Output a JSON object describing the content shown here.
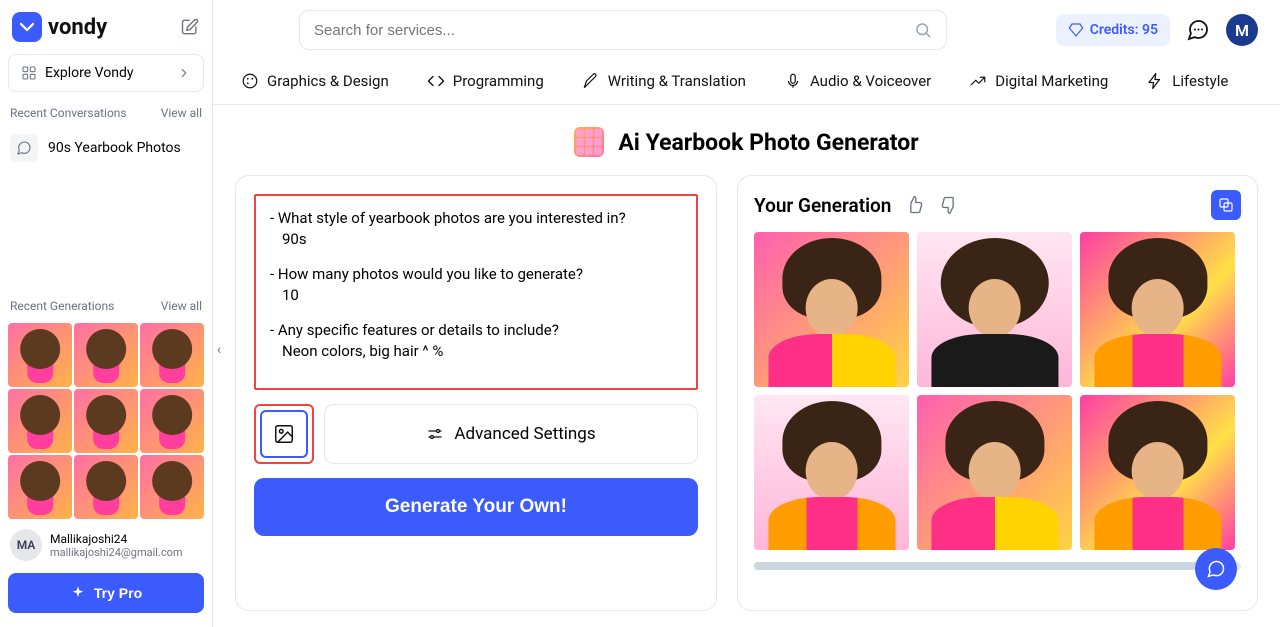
{
  "brand": "vondy",
  "sidebar": {
    "explore_label": "Explore Vondy",
    "recent_conv_label": "Recent Conversations",
    "view_all": "View all",
    "conversations": [
      {
        "label": "90s Yearbook Photos"
      }
    ],
    "recent_gen_label": "Recent Generations",
    "user": {
      "name": "Mallikajoshi24",
      "email": "mallikajoshi24@gmail.com",
      "initials": "MA"
    },
    "try_pro": "Try Pro"
  },
  "header": {
    "search_placeholder": "Search for services...",
    "credits_label": "Credits: 95",
    "avatar_letter": "M"
  },
  "tabs": [
    {
      "label": "Graphics & Design"
    },
    {
      "label": "Programming"
    },
    {
      "label": "Writing & Translation"
    },
    {
      "label": "Audio & Voiceover"
    },
    {
      "label": "Digital Marketing"
    },
    {
      "label": "Lifestyle"
    }
  ],
  "page": {
    "title": "Ai Yearbook Photo Generator"
  },
  "prompt": {
    "q1": "- What style of yearbook photos are you interested in?",
    "a1": "  90s",
    "q2": "- How many photos would you like to generate?",
    "a2": "  10",
    "q3": "- Any specific features or details to include?",
    "a3": "  Neon colors, big hair ^ %"
  },
  "controls": {
    "advanced": "Advanced Settings",
    "generate": "Generate Your Own!"
  },
  "generation": {
    "title": "Your Generation"
  }
}
